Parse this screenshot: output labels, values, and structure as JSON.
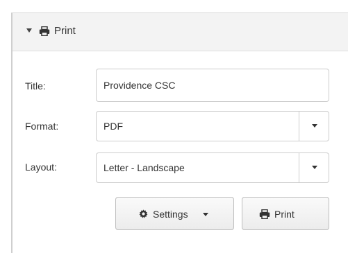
{
  "panel": {
    "title": "Print",
    "caret_icon": "caret-down-icon",
    "icon": "printer-icon"
  },
  "form": {
    "title_label": "Title:",
    "title_value": "Providence CSC",
    "format_label": "Format:",
    "format_value": "PDF",
    "layout_label": "Layout:",
    "layout_value": "Letter - Landscape"
  },
  "buttons": {
    "settings_label": "Settings",
    "settings_icon": "gear-icon",
    "print_label": "Print",
    "print_icon": "printer-icon"
  },
  "colors": {
    "header_bg": "#f3f3f3",
    "border": "#cccccc",
    "text": "#333333"
  }
}
